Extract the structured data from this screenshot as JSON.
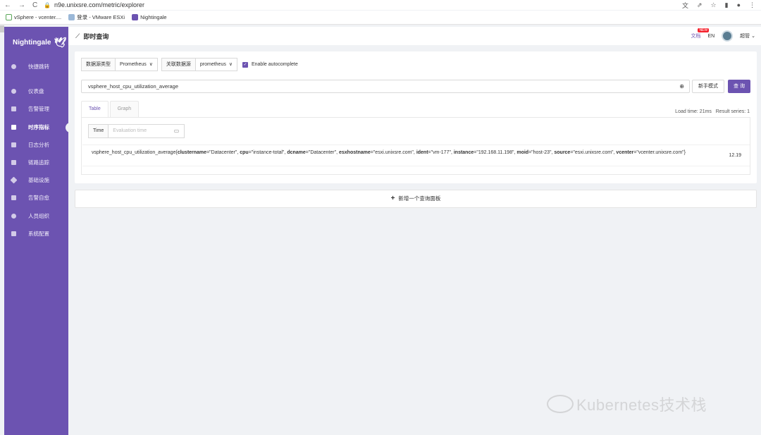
{
  "browser": {
    "url": "n9e.unixsre.com/metric/explorer",
    "bookmarks": [
      "vSphere - vcenter....",
      "登录 - VMware ESXi",
      "Nightingale"
    ]
  },
  "sidebar": {
    "brand": "Nightingale",
    "items": [
      {
        "label": "快捷跳转"
      },
      {
        "label": "仪表盘"
      },
      {
        "label": "告警管理"
      },
      {
        "label": "时序指标",
        "active": true
      },
      {
        "label": "日志分析"
      },
      {
        "label": "链路追踪"
      },
      {
        "label": "基础设施"
      },
      {
        "label": "告警自愈"
      },
      {
        "label": "人员组织"
      },
      {
        "label": "系统配置"
      }
    ]
  },
  "header": {
    "title": "即时查询",
    "doc_link": "文档",
    "new_badge": "NEW",
    "lang": "EN",
    "user": "超管"
  },
  "query": {
    "ds_type_label": "数据源类型",
    "ds_type_value": "Prometheus",
    "ds_label": "关联数据源",
    "ds_value": "prometheus",
    "autocomplete_label": "Enable autocomplete",
    "expression": "vsphere_host_cpu_utilization_average",
    "novice_button": "新手模式",
    "query_button": "查 询"
  },
  "tabs": [
    "Table",
    "Graph"
  ],
  "load_info": "Load time: 21ms   Result series: 1",
  "time": {
    "label": "Time",
    "placeholder": "Evaluation time"
  },
  "result": {
    "metric": "vsphere_host_cpu_utilization_average",
    "labels": [
      {
        "k": "clustername",
        "v": "\"Datacenter\""
      },
      {
        "k": "cpu",
        "v": "\"instance-total\""
      },
      {
        "k": "dcname",
        "v": "\"Datacenter\""
      },
      {
        "k": "esxhostname",
        "v": "\"esxi.unixsre.com\""
      },
      {
        "k": "ident",
        "v": "\"vm-177\""
      },
      {
        "k": "instance",
        "v": "\"192.168.11.198\""
      },
      {
        "k": "moid",
        "v": "\"host-23\""
      },
      {
        "k": "source",
        "v": "\"esxi.unixsre.com\""
      },
      {
        "k": "vcenter",
        "v": "\"vcenter.unixsre.com\""
      }
    ],
    "value": "12.19"
  },
  "add_panel": "新增一个查询面板",
  "watermark": "Kubernetes技术栈"
}
